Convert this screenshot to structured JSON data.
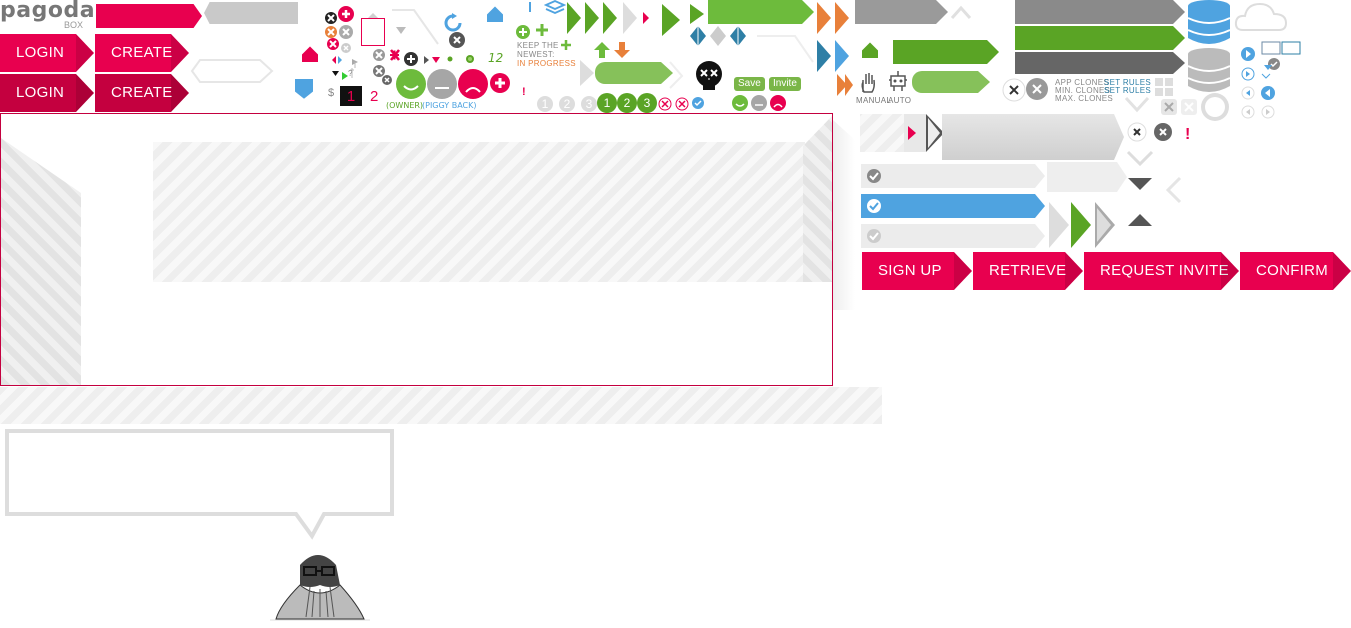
{
  "brand": {
    "logo_text": "pagoda",
    "logo_sub": "BOX"
  },
  "auth_buttons": {
    "login": "LOGIN",
    "create": "CREATE"
  },
  "action_buttons": {
    "sign_up": "SIGN UP",
    "retrieve": "RETRIEVE",
    "request_invite": "REQUEST INVITE",
    "confirm": "CONFIRM"
  },
  "misc_labels": {
    "owner": "(OWNER)",
    "piggy_back": "(PIGGY BACK)",
    "keep_newest_1": "KEEP THE",
    "keep_newest_2": "NEWEST:",
    "in_progress": "IN PROGRESS",
    "manual": "MANUAL",
    "auto": "AUTO",
    "app_clones": "APP CLONES",
    "min_clones": "MIN. CLONES",
    "max_clones": "MAX. CLONES",
    "set_rules": "SET RULES",
    "dollar": "$",
    "one_badge": "1",
    "two_label": "2",
    "twelve": "12",
    "exclaim": "!"
  },
  "small_buttons": {
    "save": "Save",
    "invite": "Invite"
  },
  "step_numbers": [
    "1",
    "2",
    "3"
  ],
  "colors": {
    "brand_red": "#e8004f",
    "green": "#5aa425",
    "blue": "#4fa3e0",
    "gray": "#8a8a8a",
    "orange": "#e8803a",
    "teal": "#2e7fa6"
  }
}
